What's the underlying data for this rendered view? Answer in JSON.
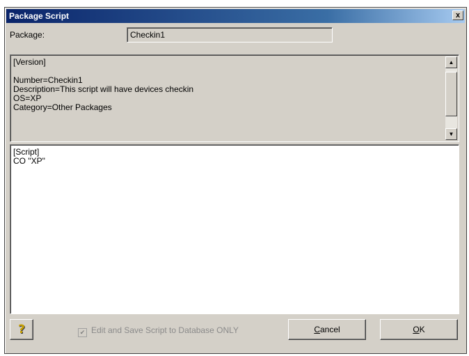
{
  "window": {
    "title": "Package Script",
    "close_label": "x"
  },
  "package": {
    "label": "Package:",
    "value": "Checkin1"
  },
  "version_section": {
    "text": "[Version]\n\nNumber=Checkin1\nDescription=This script will have devices checkin\nOS=XP\nCategory=Other Packages",
    "scroll_up_icon": "arrow-up-icon",
    "scroll_down_icon": "arrow-down-icon"
  },
  "script_section": {
    "text": "[Script]\nCO \"XP\""
  },
  "footer": {
    "help_icon": "question-mark-icon",
    "help_glyph": "?",
    "checkbox_label": "Edit and Save Script to Database ONLY",
    "checkbox_checked": true,
    "checkbox_enabled": false,
    "cancel_mnemonic": "C",
    "cancel_rest": "ancel",
    "ok_mnemonic": "O",
    "ok_rest": "K"
  },
  "colors": {
    "dialog_bg": "#d4d0c8",
    "title_gradient_start": "#0a246a",
    "title_gradient_end": "#a6caf0"
  }
}
